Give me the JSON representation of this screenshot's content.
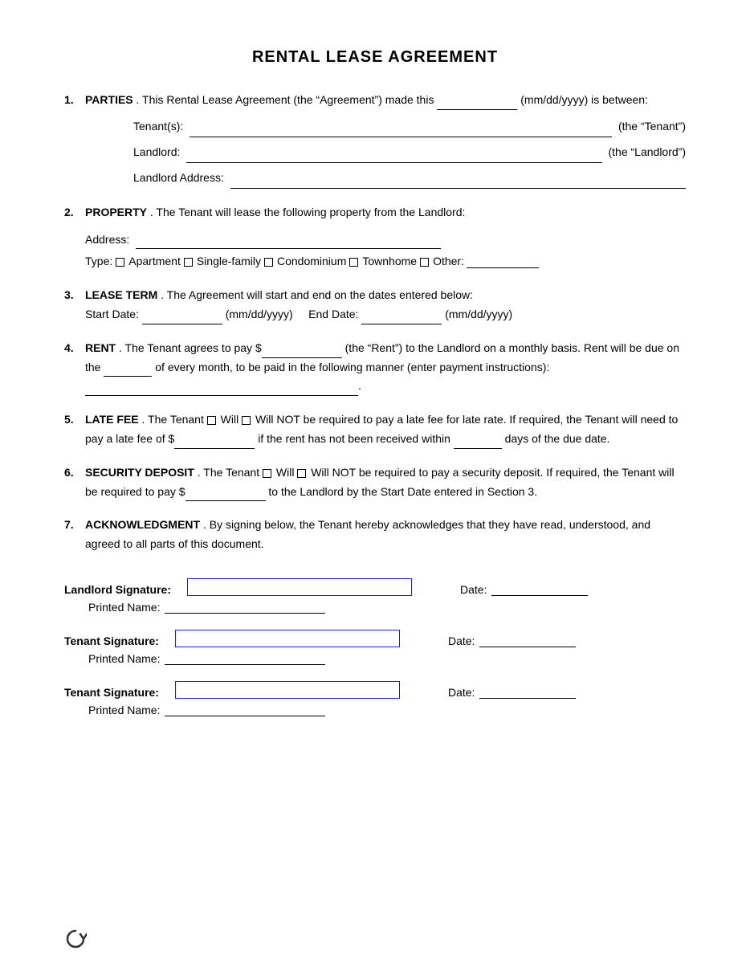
{
  "title": "RENTAL LEASE AGREEMENT",
  "sections": [
    {
      "number": "1.",
      "heading": "PARTIES",
      "text_before_heading": "",
      "content": ". This Rental Lease Agreement (the “Agreement”) made this ____________ (mm/dd/yyyy) is between:"
    },
    {
      "number": "2.",
      "heading": "PROPERTY",
      "content": ". The Tenant will lease the following property from the Landlord:"
    },
    {
      "number": "3.",
      "heading": "LEASE TERM",
      "content": ". The Agreement will start and end on the dates entered below:"
    },
    {
      "number": "4.",
      "heading": "RENT",
      "content": ". The Tenant agrees to pay $____________ (the “Rent”) to the Landlord on a monthly basis. Rent will be due on the ________ of every month, to be paid in the following manner (enter payment instructions): ____________________________________________."
    },
    {
      "number": "5.",
      "heading": "LATE FEE",
      "content": ". The Tenant □ Will □ Will NOT be required to pay a late fee for late rate. If required, the Tenant will need to pay a late fee of $__________ if the rent has not been received within ________ days of the due date."
    },
    {
      "number": "6.",
      "heading": "SECURITY DEPOSIT",
      "content": ". The Tenant □ Will □ Will NOT be required to pay a security deposit. If required, the Tenant will be required to pay $__________ to the Landlord by the Start Date entered in Section 3."
    },
    {
      "number": "7.",
      "heading": "ACKNOWLEDGMENT",
      "content": ". By signing below, the Tenant hereby acknowledges that they have read, understood, and agreed to all parts of this document."
    }
  ],
  "parties": {
    "tenants_label": "Tenant(s):",
    "tenants_suffix": "(the “Tenant”)",
    "landlord_label": "Landlord:",
    "landlord_suffix": "(the “Landlord”)",
    "landlord_address_label": "Landlord Address:"
  },
  "property": {
    "address_label": "Address:",
    "type_label": "Type:",
    "types": [
      "Apartment",
      "Single-family",
      "Condominium",
      "Townhome",
      "Other:"
    ]
  },
  "lease_term": {
    "start_label": "Start Date:",
    "start_format": "(mm/dd/yyyy)",
    "end_label": "End Date:",
    "end_format": "(mm/dd/yyyy)"
  },
  "signatures": [
    {
      "role": "Landlord Signature:",
      "date_label": "Date:",
      "printed_label": "Printed Name:"
    },
    {
      "role": "Tenant Signature:",
      "date_label": "Date:",
      "printed_label": "Printed Name:"
    },
    {
      "role": "Tenant Signature:",
      "date_label": "Date:",
      "printed_label": "Printed Name:"
    }
  ],
  "footer_icon": "⟳"
}
